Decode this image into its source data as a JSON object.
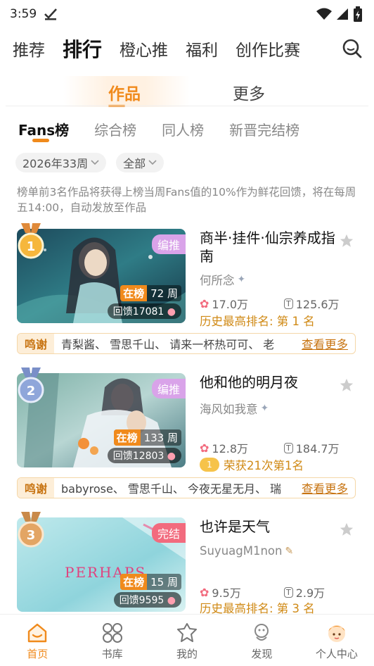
{
  "status_bar": {
    "time": "3:59"
  },
  "top_nav": {
    "tabs": [
      {
        "label": "推荐",
        "active": false
      },
      {
        "label": "排行",
        "active": true
      },
      {
        "label": "橙心推",
        "active": false
      },
      {
        "label": "福利",
        "active": false
      },
      {
        "label": "创作比赛",
        "active": false
      }
    ]
  },
  "sub_tabs": {
    "works": "作品",
    "more": "更多"
  },
  "rank_tabs": [
    "Fans榜",
    "综合榜",
    "同人榜",
    "新晋完结榜"
  ],
  "filters": {
    "week": "2026年33周",
    "scope": "全部"
  },
  "notice": "榜单前3名作品将获得上榜当周Fans值的10%作为鲜花回馈，将在每周五14:00，自动发放至作品",
  "colors": {
    "accent": "#f08a1c",
    "history_text": "#d08a16"
  },
  "entries": [
    {
      "rank": "1",
      "title": "商半·挂件·仙宗养成指南",
      "author": "何所念",
      "cover_tag": "编推",
      "on_list_label": "在榜",
      "weeks": "72 周",
      "reward": "回馈17081",
      "flowers": "17.0万",
      "tickets": "125.6万",
      "extra": "历史最高排名: 第 1 名",
      "thanks_label": "鸣谢",
      "thanks_names": "青梨酱、 雪思千山、 请来一杯热可可、 老",
      "see_more": "查看更多"
    },
    {
      "rank": "2",
      "title": "他和他的明月夜",
      "author": "海风如我意",
      "cover_tag": "编推",
      "on_list_label": "在榜",
      "weeks": "133 周",
      "reward": "回馈12803",
      "flowers": "12.8万",
      "tickets": "184.7万",
      "extra": "荣获21次第1名",
      "thanks_label": "鸣谢",
      "thanks_names": "babyrose、 雪思千山、 今夜无星无月、 瑞",
      "see_more": "查看更多"
    },
    {
      "rank": "3",
      "title": "也许是天气",
      "author": "SuyuagM1non",
      "cover_tag": "完结",
      "cover_text": "PERHAPS",
      "on_list_label": "在榜",
      "weeks": "15 周",
      "reward": "回馈9595",
      "flowers": "9.5万",
      "tickets": "2.9万",
      "extra": "历史最高排名: 第 3 名"
    }
  ],
  "bottom_nav": [
    {
      "label": "首页",
      "icon": "home-icon",
      "active": true
    },
    {
      "label": "书库",
      "icon": "library-icon",
      "active": false
    },
    {
      "label": "我的",
      "icon": "mine-icon",
      "active": false
    },
    {
      "label": "发现",
      "icon": "discover-icon",
      "active": false
    },
    {
      "label": "个人中心",
      "icon": "profile-icon",
      "active": false
    }
  ]
}
